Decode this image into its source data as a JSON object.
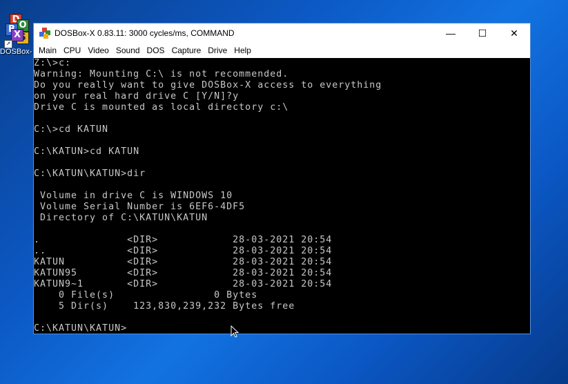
{
  "desktop": {
    "icon_label": "DOSBox-",
    "logo_letters": [
      "D",
      "O",
      "B",
      "S",
      "X"
    ]
  },
  "window": {
    "title": "DOSBox-X 0.83.11: 3000 cycles/ms, COMMAND",
    "controls": {
      "minimize": "—",
      "maximize": "☐",
      "close": "✕"
    },
    "menu": [
      "Main",
      "CPU",
      "Video",
      "Sound",
      "DOS",
      "Capture",
      "Drive",
      "Help"
    ]
  },
  "console": {
    "lines": [
      "Z:\\>c:",
      "Warning: Mounting C:\\ is not recommended.",
      "Do you really want to give DOSBox-X access to everything",
      "on your real hard drive C [Y/N]?y",
      "Drive C is mounted as local directory c:\\",
      "",
      "C:\\>cd KATUN",
      "",
      "C:\\KATUN>cd KATUN",
      "",
      "C:\\KATUN\\KATUN>dir",
      "",
      " Volume in drive C is WINDOWS 10",
      " Volume Serial Number is 6EF6-4DF5",
      " Directory of C:\\KATUN\\KATUN",
      "",
      ".              <DIR>            28-03-2021 20:54",
      "..             <DIR>            28-03-2021 20:54",
      "KATUN          <DIR>            28-03-2021 20:54",
      "KATUN95        <DIR>            28-03-2021 20:54",
      "KATUN9~1       <DIR>            28-03-2021 20:54",
      "    0 File(s)                0 Bytes",
      "    5 Dir(s)    123,830,239,232 Bytes free",
      "",
      "C:\\KATUN\\KATUN>"
    ]
  },
  "colors": {
    "desktop_bg": "#0c5ac7",
    "console_bg": "#000000",
    "console_fg": "#c8c8c8"
  }
}
